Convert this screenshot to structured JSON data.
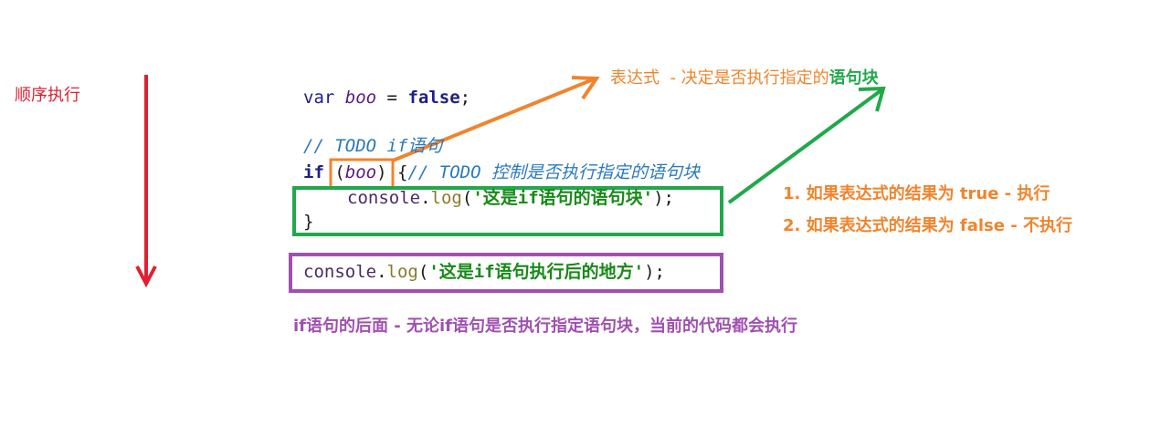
{
  "labels": {
    "sequence": "顺序执行",
    "expression_prefix": "表达式  - 决定是否执行指定的",
    "expression_block": "语句块",
    "result_true": "1. 如果表达式的结果为 true - 执行",
    "result_false": "2. 如果表达式的结果为 false - 不执行",
    "after_if": "if语句的后面 - 无论if语句是否执行指定语句块，当前的代码都会执行"
  },
  "code": {
    "line1": {
      "kw": "var",
      "ident": "boo",
      "op": " = ",
      "val": "false",
      "end": ";"
    },
    "line2": {
      "comment": "// TODO if语句"
    },
    "line3": {
      "kw": "if",
      "open": "(",
      "ident": "boo",
      "close": ")",
      "brace": " {",
      "comment": "// TODO 控制是否执行指定的语句块"
    },
    "line4": {
      "obj": "console",
      "dot": ".",
      "method": "log",
      "open": "(",
      "str": "'这是if语句的语句块'",
      "close": ");"
    },
    "line5": {
      "brace": "}"
    },
    "line6": {
      "obj": "console",
      "dot": ".",
      "method": "log",
      "open": "(",
      "str": "'这是if语句执行后的地方'",
      "close": ");"
    }
  },
  "colors": {
    "red": "#e02030",
    "orange": "#f0842c",
    "green": "#22a84a",
    "purple": "#a050b0"
  }
}
